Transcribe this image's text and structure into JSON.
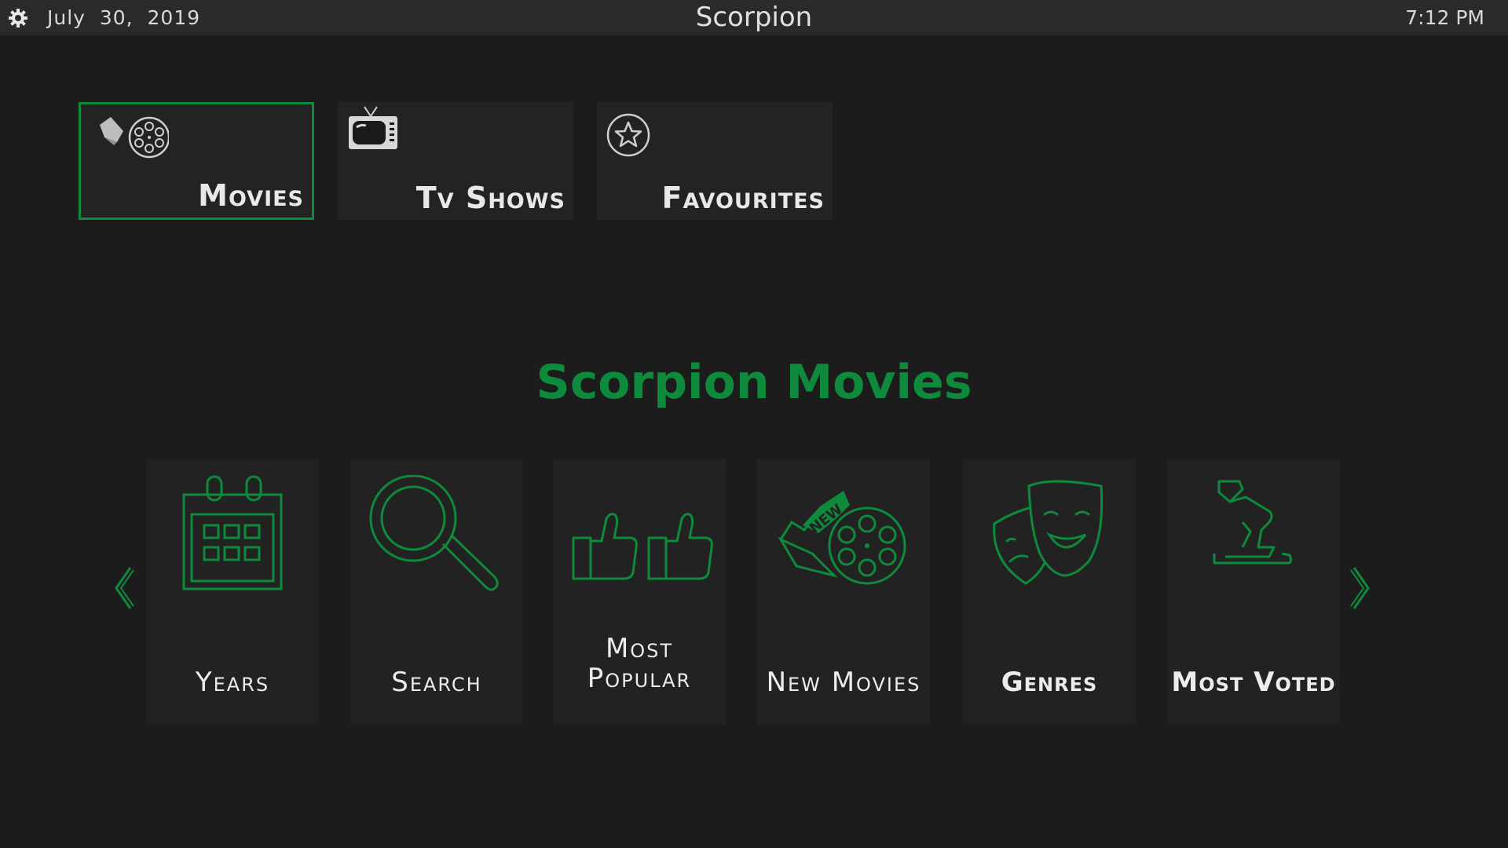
{
  "topbar": {
    "settings_icon": "gear-icon",
    "date": "July  30,  2019",
    "title": "Scorpion",
    "time": "7:12 PM"
  },
  "menu": {
    "tiles": [
      {
        "label": "Movies",
        "icon": "film-reel-icon",
        "selected": true
      },
      {
        "label": "Tv Shows",
        "icon": "tv-icon",
        "selected": false
      },
      {
        "label": "Favourites",
        "icon": "star-icon",
        "selected": false
      }
    ]
  },
  "section": {
    "title": "Scorpion Movies"
  },
  "categories": [
    {
      "label": "Years",
      "icon": "calendar-icon"
    },
    {
      "label": "Search",
      "icon": "magnifier-icon"
    },
    {
      "label": "Most Popular",
      "label_line1": "Most",
      "label_line2": "Popular",
      "icon": "thumbs-up-icon"
    },
    {
      "label": "New Movies",
      "icon": "new-film-reel-icon"
    },
    {
      "label": "Genres",
      "icon": "theater-masks-icon"
    },
    {
      "label": "Most Voted",
      "icon": "voting-hand-icon"
    }
  ],
  "nav": {
    "prev_icon": "chevron-left-icon",
    "next_icon": "chevron-right-icon"
  },
  "colors": {
    "accent": "#0e8a3c",
    "background": "#1c1c1c",
    "topbar": "#2a2a2a",
    "tile": "#232323"
  }
}
